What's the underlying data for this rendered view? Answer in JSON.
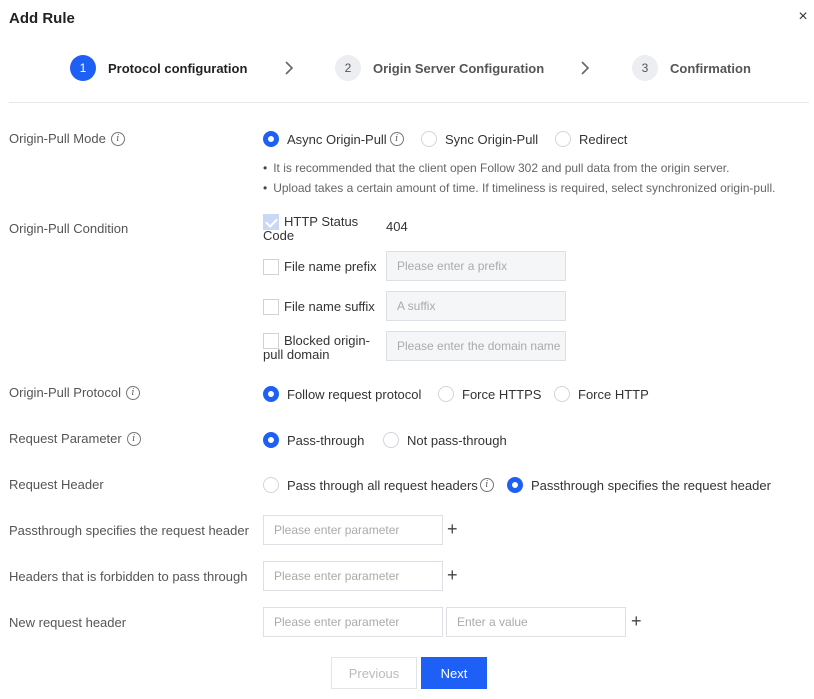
{
  "dialog": {
    "title": "Add Rule",
    "close": "×"
  },
  "steps": [
    {
      "num": "1",
      "label": "Protocol configuration"
    },
    {
      "num": "2",
      "label": "Origin Server Configuration"
    },
    {
      "num": "3",
      "label": "Confirmation"
    }
  ],
  "origin_pull_mode": {
    "label": "Origin-Pull Mode",
    "options": [
      "Async Origin-Pull",
      "Sync Origin-Pull",
      "Redirect"
    ],
    "selected": "Async Origin-Pull",
    "tips": [
      "It is recommended that the client open Follow 302 and pull data from the origin server.",
      "Upload takes a certain amount of time. If timeliness is required, select synchronized origin-pull."
    ]
  },
  "origin_pull_condition": {
    "label": "Origin-Pull Condition",
    "http_status": {
      "label_line1": "HTTP Status",
      "label_line2": "Code",
      "value": "404",
      "checked": true
    },
    "prefix": {
      "label": "File name prefix",
      "placeholder": "Please enter a prefix",
      "checked": false
    },
    "suffix": {
      "label": "File name suffix",
      "placeholder": "A suffix",
      "checked": false
    },
    "blocked": {
      "label_line1": "Blocked origin-",
      "label_line2": "pull domain",
      "placeholder": "Please enter the domain name",
      "checked": false
    }
  },
  "origin_pull_protocol": {
    "label": "Origin-Pull Protocol",
    "options": [
      "Follow request protocol",
      "Force HTTPS",
      "Force HTTP"
    ],
    "selected": "Follow request protocol"
  },
  "request_parameter": {
    "label": "Request Parameter",
    "options": [
      "Pass-through",
      "Not pass-through"
    ],
    "selected": "Pass-through"
  },
  "request_header": {
    "label": "Request Header",
    "options": [
      "Pass through all request headers",
      "Passthrough specifies the request header"
    ],
    "selected": "Passthrough specifies the request header"
  },
  "passthrough_header": {
    "label": "Passthrough specifies the request header",
    "placeholder": "Please enter parameter"
  },
  "forbidden_header": {
    "label": "Headers that is forbidden to pass through",
    "placeholder": "Please enter parameter"
  },
  "new_header": {
    "label": "New request header",
    "name_placeholder": "Please enter parameter",
    "value_placeholder": "Enter a value"
  },
  "buttons": {
    "previous": "Previous",
    "next": "Next"
  },
  "colors": {
    "accent": "#1e5ff5"
  }
}
